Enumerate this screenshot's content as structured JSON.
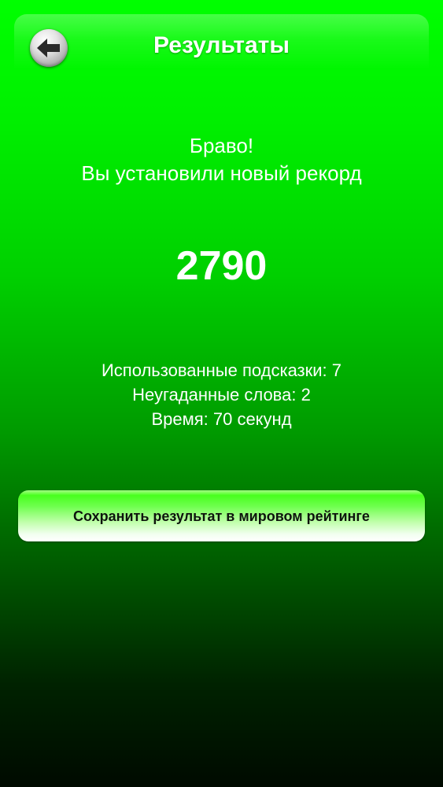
{
  "header": {
    "title": "Результаты",
    "back_icon": "arrow-left-icon"
  },
  "message": {
    "line1": "Браво!",
    "line2": "Вы установили новый рекорд"
  },
  "score": "2790",
  "stats": {
    "hints": "Использованные подсказки: 7",
    "unguessed": "Неугаданные слова: 2",
    "time": "Время: 70 секунд"
  },
  "actions": {
    "save_label": "Сохранить результат в мировом рейтинге"
  },
  "colors": {
    "background_top": "#00ff00",
    "background_bottom": "#000a00",
    "text": "#ffffff",
    "button_text": "#0d140d"
  }
}
